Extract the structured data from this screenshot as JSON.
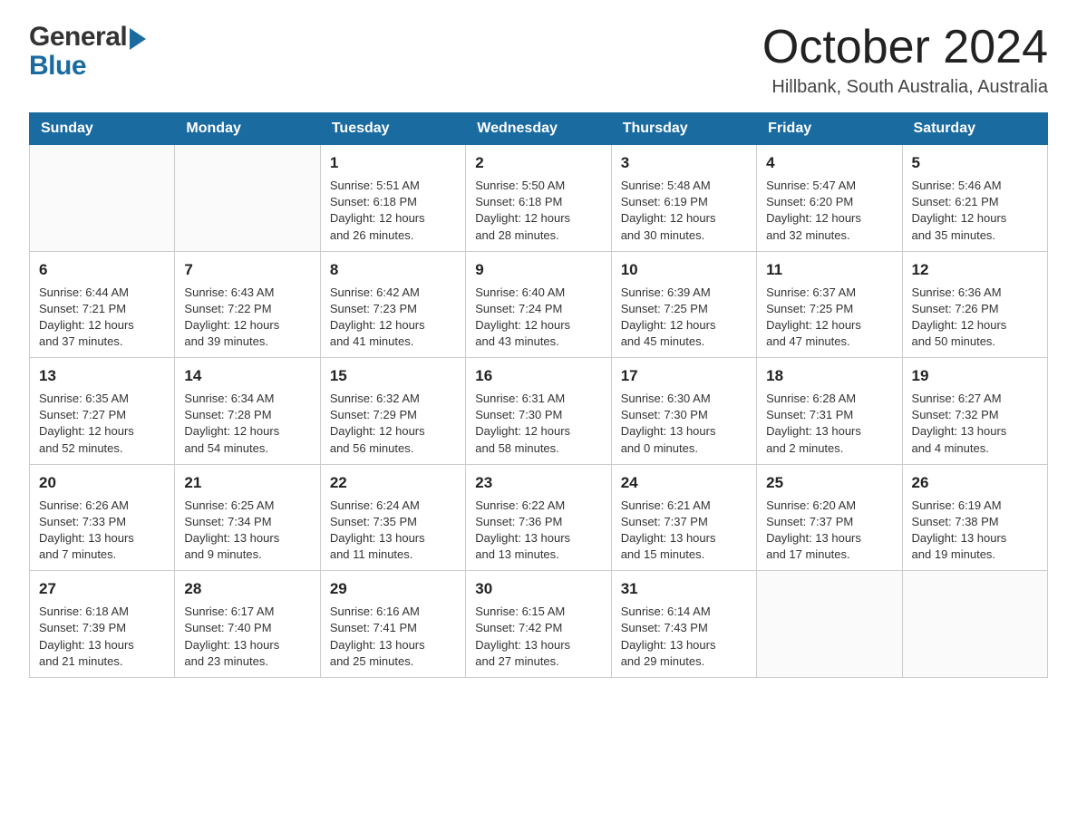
{
  "header": {
    "month_title": "October 2024",
    "location": "Hillbank, South Australia, Australia",
    "logo_general": "General",
    "logo_blue": "Blue"
  },
  "calendar": {
    "days_of_week": [
      "Sunday",
      "Monday",
      "Tuesday",
      "Wednesday",
      "Thursday",
      "Friday",
      "Saturday"
    ],
    "weeks": [
      [
        {
          "day": "",
          "info": ""
        },
        {
          "day": "",
          "info": ""
        },
        {
          "day": "1",
          "info": "Sunrise: 5:51 AM\nSunset: 6:18 PM\nDaylight: 12 hours\nand 26 minutes."
        },
        {
          "day": "2",
          "info": "Sunrise: 5:50 AM\nSunset: 6:18 PM\nDaylight: 12 hours\nand 28 minutes."
        },
        {
          "day": "3",
          "info": "Sunrise: 5:48 AM\nSunset: 6:19 PM\nDaylight: 12 hours\nand 30 minutes."
        },
        {
          "day": "4",
          "info": "Sunrise: 5:47 AM\nSunset: 6:20 PM\nDaylight: 12 hours\nand 32 minutes."
        },
        {
          "day": "5",
          "info": "Sunrise: 5:46 AM\nSunset: 6:21 PM\nDaylight: 12 hours\nand 35 minutes."
        }
      ],
      [
        {
          "day": "6",
          "info": "Sunrise: 6:44 AM\nSunset: 7:21 PM\nDaylight: 12 hours\nand 37 minutes."
        },
        {
          "day": "7",
          "info": "Sunrise: 6:43 AM\nSunset: 7:22 PM\nDaylight: 12 hours\nand 39 minutes."
        },
        {
          "day": "8",
          "info": "Sunrise: 6:42 AM\nSunset: 7:23 PM\nDaylight: 12 hours\nand 41 minutes."
        },
        {
          "day": "9",
          "info": "Sunrise: 6:40 AM\nSunset: 7:24 PM\nDaylight: 12 hours\nand 43 minutes."
        },
        {
          "day": "10",
          "info": "Sunrise: 6:39 AM\nSunset: 7:25 PM\nDaylight: 12 hours\nand 45 minutes."
        },
        {
          "day": "11",
          "info": "Sunrise: 6:37 AM\nSunset: 7:25 PM\nDaylight: 12 hours\nand 47 minutes."
        },
        {
          "day": "12",
          "info": "Sunrise: 6:36 AM\nSunset: 7:26 PM\nDaylight: 12 hours\nand 50 minutes."
        }
      ],
      [
        {
          "day": "13",
          "info": "Sunrise: 6:35 AM\nSunset: 7:27 PM\nDaylight: 12 hours\nand 52 minutes."
        },
        {
          "day": "14",
          "info": "Sunrise: 6:34 AM\nSunset: 7:28 PM\nDaylight: 12 hours\nand 54 minutes."
        },
        {
          "day": "15",
          "info": "Sunrise: 6:32 AM\nSunset: 7:29 PM\nDaylight: 12 hours\nand 56 minutes."
        },
        {
          "day": "16",
          "info": "Sunrise: 6:31 AM\nSunset: 7:30 PM\nDaylight: 12 hours\nand 58 minutes."
        },
        {
          "day": "17",
          "info": "Sunrise: 6:30 AM\nSunset: 7:30 PM\nDaylight: 13 hours\nand 0 minutes."
        },
        {
          "day": "18",
          "info": "Sunrise: 6:28 AM\nSunset: 7:31 PM\nDaylight: 13 hours\nand 2 minutes."
        },
        {
          "day": "19",
          "info": "Sunrise: 6:27 AM\nSunset: 7:32 PM\nDaylight: 13 hours\nand 4 minutes."
        }
      ],
      [
        {
          "day": "20",
          "info": "Sunrise: 6:26 AM\nSunset: 7:33 PM\nDaylight: 13 hours\nand 7 minutes."
        },
        {
          "day": "21",
          "info": "Sunrise: 6:25 AM\nSunset: 7:34 PM\nDaylight: 13 hours\nand 9 minutes."
        },
        {
          "day": "22",
          "info": "Sunrise: 6:24 AM\nSunset: 7:35 PM\nDaylight: 13 hours\nand 11 minutes."
        },
        {
          "day": "23",
          "info": "Sunrise: 6:22 AM\nSunset: 7:36 PM\nDaylight: 13 hours\nand 13 minutes."
        },
        {
          "day": "24",
          "info": "Sunrise: 6:21 AM\nSunset: 7:37 PM\nDaylight: 13 hours\nand 15 minutes."
        },
        {
          "day": "25",
          "info": "Sunrise: 6:20 AM\nSunset: 7:37 PM\nDaylight: 13 hours\nand 17 minutes."
        },
        {
          "day": "26",
          "info": "Sunrise: 6:19 AM\nSunset: 7:38 PM\nDaylight: 13 hours\nand 19 minutes."
        }
      ],
      [
        {
          "day": "27",
          "info": "Sunrise: 6:18 AM\nSunset: 7:39 PM\nDaylight: 13 hours\nand 21 minutes."
        },
        {
          "day": "28",
          "info": "Sunrise: 6:17 AM\nSunset: 7:40 PM\nDaylight: 13 hours\nand 23 minutes."
        },
        {
          "day": "29",
          "info": "Sunrise: 6:16 AM\nSunset: 7:41 PM\nDaylight: 13 hours\nand 25 minutes."
        },
        {
          "day": "30",
          "info": "Sunrise: 6:15 AM\nSunset: 7:42 PM\nDaylight: 13 hours\nand 27 minutes."
        },
        {
          "day": "31",
          "info": "Sunrise: 6:14 AM\nSunset: 7:43 PM\nDaylight: 13 hours\nand 29 minutes."
        },
        {
          "day": "",
          "info": ""
        },
        {
          "day": "",
          "info": ""
        }
      ]
    ]
  }
}
